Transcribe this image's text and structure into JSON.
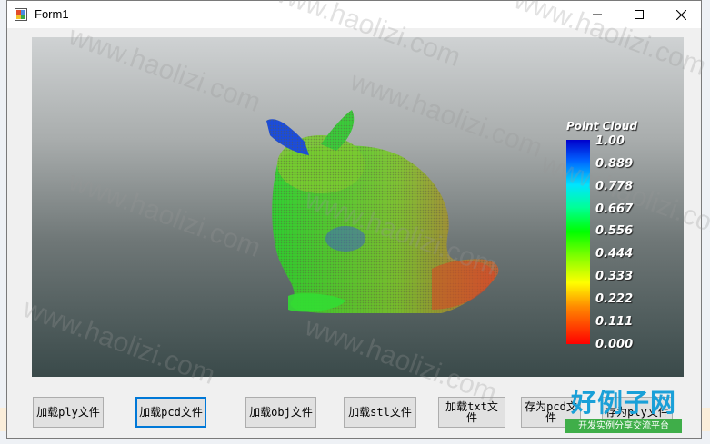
{
  "window": {
    "title": "Form1"
  },
  "controls": {
    "minimize": "minimize",
    "maximize": "maximize",
    "close": "close"
  },
  "legend": {
    "title": "Point Cloud",
    "ticks": [
      "1.00",
      "0.889",
      "0.778",
      "0.667",
      "0.556",
      "0.444",
      "0.333",
      "0.222",
      "0.111",
      "0.000"
    ],
    "colors": [
      "#0000cc",
      "#0060ff",
      "#00e5ff",
      "#00ff99",
      "#00ff00",
      "#80ff00",
      "#ffff00",
      "#ff8800",
      "#ff0000"
    ]
  },
  "buttons": [
    {
      "label": "加载ply文件"
    },
    {
      "label": "加载pcd文件"
    },
    {
      "label": "加载obj文件"
    },
    {
      "label": "加载stl文件"
    },
    {
      "label": "加载txt文件"
    },
    {
      "label": "存为pcd文件"
    },
    {
      "label": "存为ply文件"
    }
  ],
  "watermark": {
    "text": "www.haolizi.com"
  },
  "brand": {
    "main": "好例子网",
    "sub": "开发实例分享交流平台"
  }
}
